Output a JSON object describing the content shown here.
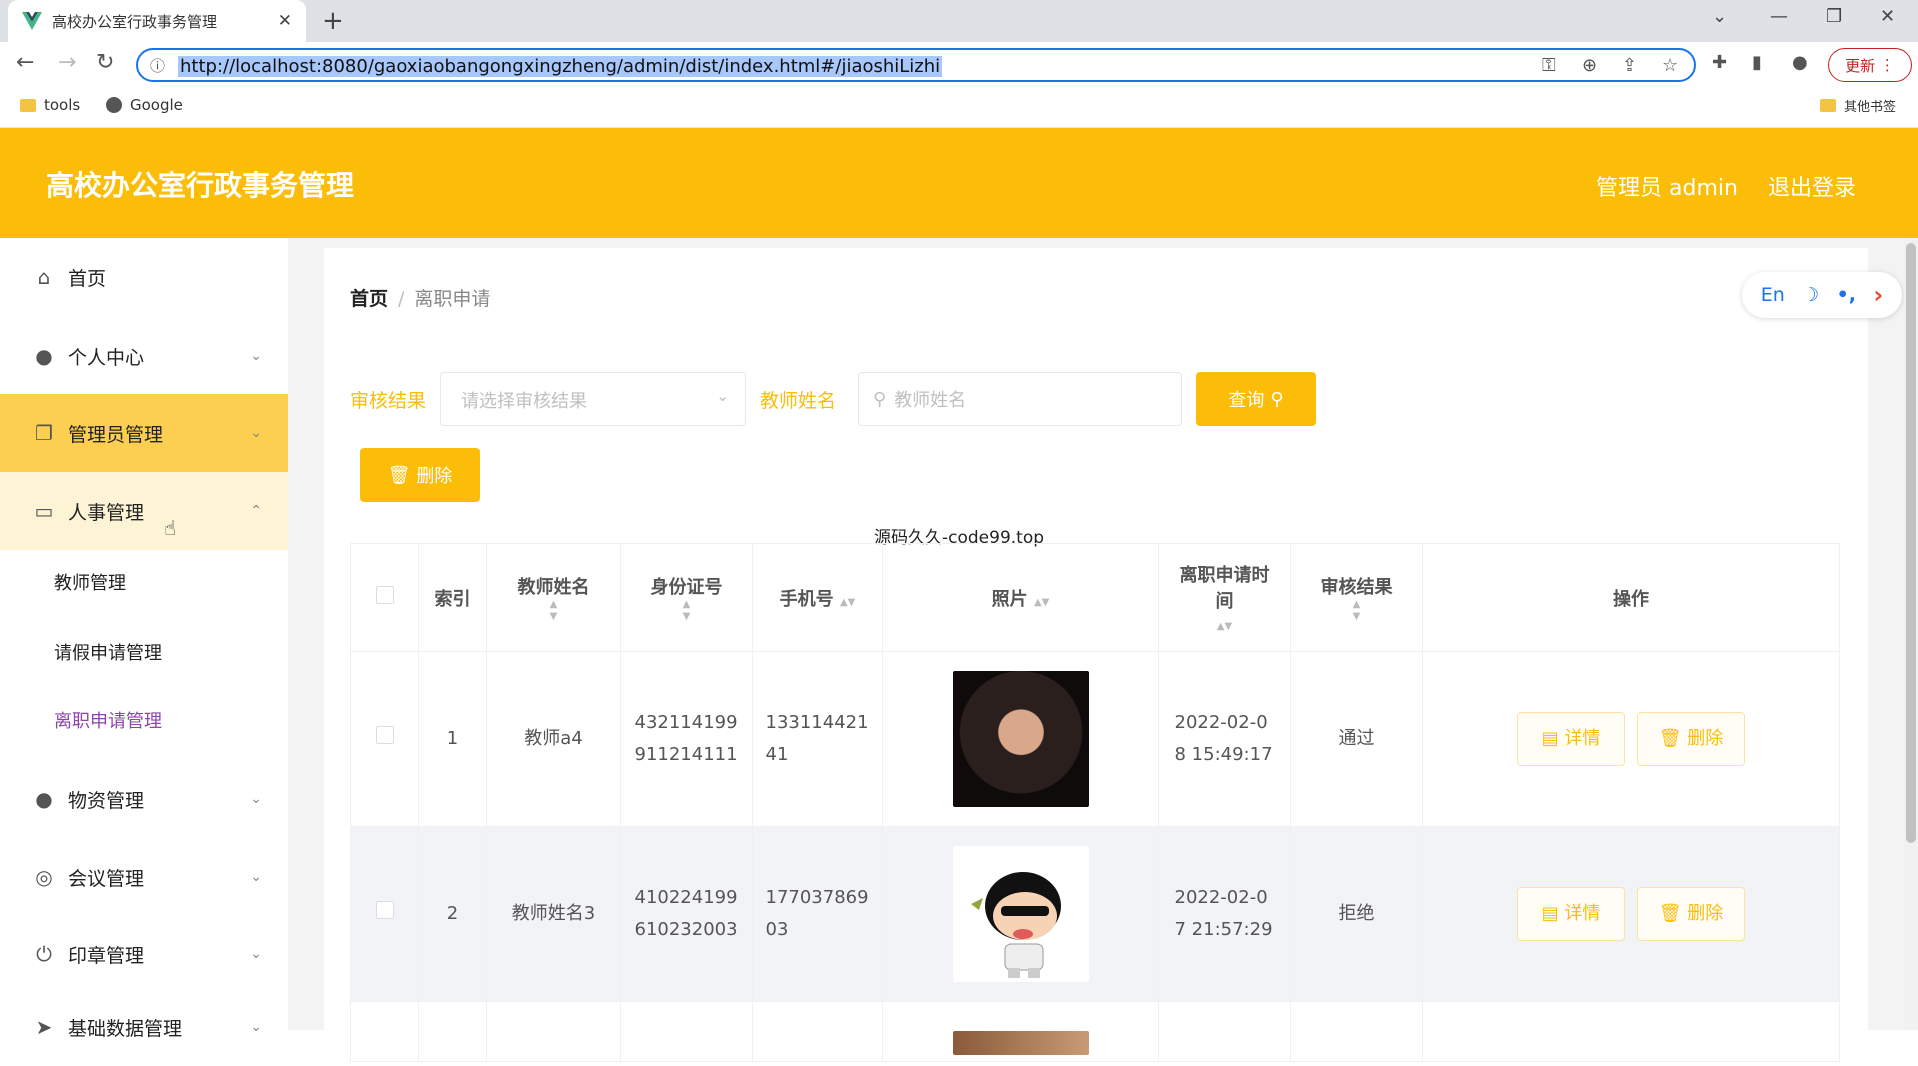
{
  "browser": {
    "tab_title": "高校办公室行政事务管理",
    "tab_close": "✕",
    "new_tab": "+",
    "url": "http://localhost:8080/gaoxiaobangongxingzheng/admin/dist/index.html#/jiaoshiLizhi",
    "update_label": "更新",
    "bookmarks": [
      "tools",
      "Google"
    ],
    "other_bookmarks": "其他书签"
  },
  "header": {
    "brand": "高校办公室行政事务管理",
    "user": "管理员 admin",
    "logout": "退出登录"
  },
  "sidebar": {
    "items": [
      {
        "label": "首页",
        "icon": "home-icon"
      },
      {
        "label": "个人中心",
        "icon": "user-icon"
      },
      {
        "label": "管理员管理",
        "icon": "copy-icon"
      },
      {
        "label": "人事管理",
        "icon": "chat-icon"
      },
      {
        "label": "物资管理",
        "icon": "user-icon"
      },
      {
        "label": "会议管理",
        "icon": "compass-icon"
      },
      {
        "label": "印章管理",
        "icon": "power-icon"
      },
      {
        "label": "基础数据管理",
        "icon": "send-icon"
      }
    ],
    "sub_items": [
      "教师管理",
      "请假申请管理",
      "离职申请管理"
    ]
  },
  "breadcrumb": {
    "home": "首页",
    "sep": "/",
    "current": "离职申请"
  },
  "lang_switch": {
    "en": "En",
    "moon": "☽",
    "dots": "•,",
    "arrow": "›"
  },
  "filters": {
    "result_label": "审核结果",
    "result_placeholder": "请选择审核结果",
    "name_label": "教师姓名",
    "name_placeholder": "教师姓名",
    "query_button": "查询",
    "delete_button": "删除"
  },
  "overlay_text": "源码久久-code99.top",
  "table": {
    "columns": [
      "索引",
      "教师姓名",
      "身份证号",
      "手机号",
      "照片",
      "离职申请时间",
      "审核结果",
      "操作"
    ],
    "rows": [
      {
        "index": "1",
        "name": "教师a4",
        "id_card": "432114199911214111",
        "phone": "13311442141",
        "time": "2022-02-08 15:49:17",
        "result": "通过"
      },
      {
        "index": "2",
        "name": "教师姓名3",
        "id_card": "410224199610232003",
        "phone": "17703786903",
        "time": "2022-02-07 21:57:29",
        "result": "拒绝"
      }
    ],
    "detail_label": "详情",
    "delete_label": "删除"
  }
}
